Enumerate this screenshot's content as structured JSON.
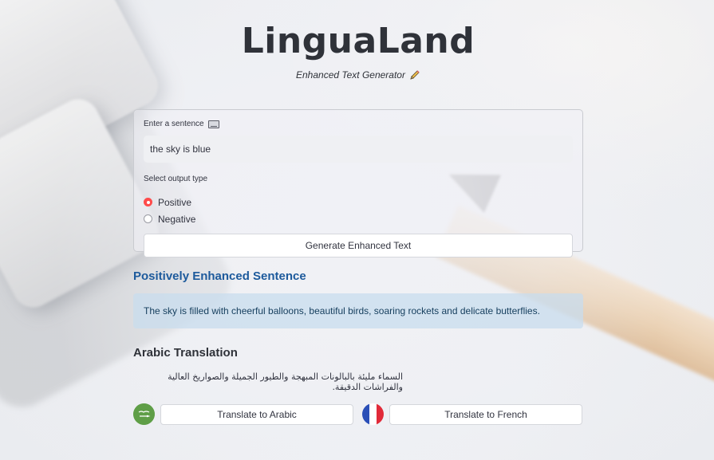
{
  "app": {
    "title": "LinguaLand",
    "subtitle": "Enhanced Text Generator"
  },
  "form": {
    "sentence_label": "Enter a sentence",
    "sentence_value": "the sky is blue",
    "output_type_label": "Select output type",
    "options": [
      {
        "label": "Positive",
        "selected": true
      },
      {
        "label": "Negative",
        "selected": false
      }
    ],
    "generate_button": "Generate Enhanced Text"
  },
  "result": {
    "heading": "Positively Enhanced Sentence",
    "text": "The sky is filled with cheerful balloons, beautiful birds, soaring rockets and delicate butterflies."
  },
  "translation": {
    "heading": "Arabic Translation",
    "arabic_text": "السماء مليئة بالبالونات المبهجة والطيور الجميلة والصواريخ العالية والفراشات الدقيقة.",
    "translate_arabic_button": "Translate to Arabic",
    "translate_french_button": "Translate to French"
  },
  "colors": {
    "accent_red": "#ff4b4b",
    "heading_blue": "#1d5a9c",
    "result_bg": "#c8dcee"
  },
  "icons": {
    "subtitle_icon": "pencil-icon",
    "label_icon": "keyboard-icon",
    "arabic_flag": "saudi-flag-icon",
    "french_flag": "france-flag-icon"
  }
}
